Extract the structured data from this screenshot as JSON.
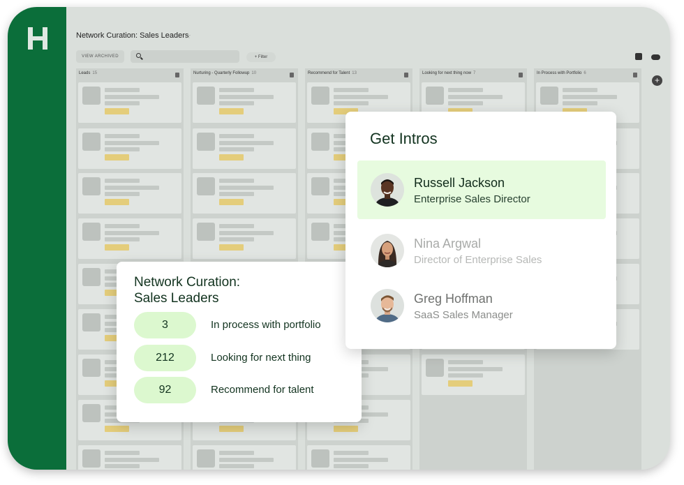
{
  "board": {
    "title": "Network Curation: Sales Leaders",
    "view_archived_label": "VIEW ARCHIVED",
    "filter_label": "+ Filter",
    "columns": [
      {
        "name": "Leads",
        "count": "15"
      },
      {
        "name": "Nurturing - Quarterly Followup",
        "count": "10"
      },
      {
        "name": "Recommend for Talent",
        "count": "13"
      },
      {
        "name": "Looking for next thing now",
        "count": "7"
      },
      {
        "name": "In Process with Portfolio",
        "count": "6"
      }
    ]
  },
  "stats_card": {
    "title_line1": "Network Curation:",
    "title_line2": "Sales Leaders",
    "rows": [
      {
        "value": "3",
        "label": "In process with portfolio"
      },
      {
        "value": "212",
        "label": "Looking for next thing"
      },
      {
        "value": "92",
        "label": "Recommend for talent"
      }
    ]
  },
  "intros_card": {
    "title": "Get Intros",
    "people": [
      {
        "name": "Russell Jackson",
        "role": "Enterprise Sales Director",
        "state": "selected"
      },
      {
        "name": "Nina Argwal",
        "role": "Director of Enterprise Sales",
        "state": "muted"
      },
      {
        "name": "Greg Hoffman",
        "role": "SaaS Sales Manager",
        "state": "normal"
      }
    ]
  },
  "colors": {
    "brand_green": "#0b6e3a",
    "pill_green": "#dcf8cf",
    "selected_row": "#e7fbdf",
    "tag_yellow": "#e4cd7b"
  }
}
